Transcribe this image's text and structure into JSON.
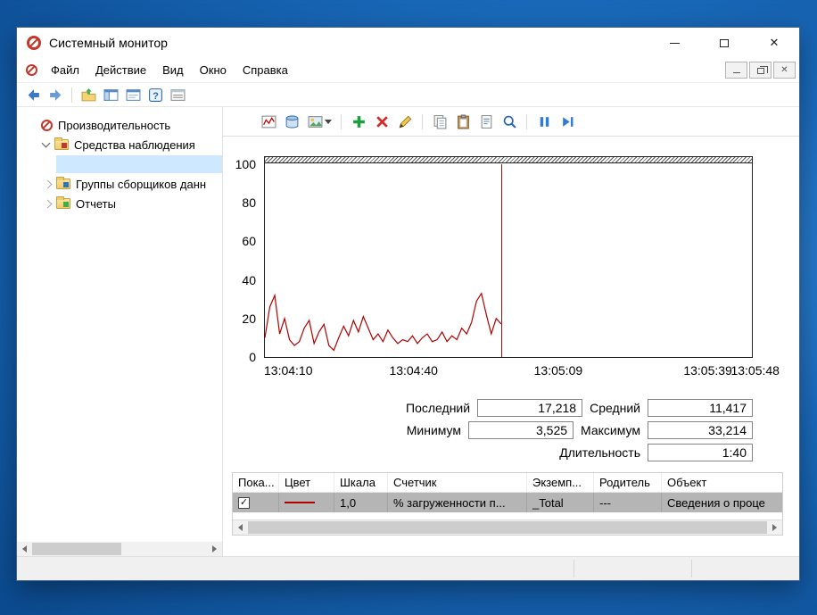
{
  "window": {
    "title": "Системный монитор"
  },
  "menu": {
    "items": [
      "Файл",
      "Действие",
      "Вид",
      "Окно",
      "Справка"
    ]
  },
  "tree": {
    "items": [
      {
        "label": "Производительность"
      },
      {
        "label": "Средства наблюдения"
      },
      {
        "label": ""
      },
      {
        "label": "Группы сборщиков данн"
      },
      {
        "label": "Отчеты"
      }
    ]
  },
  "stats": {
    "last_label": "Последний",
    "last_value": "17,218",
    "avg_label": "Средний",
    "avg_value": "11,417",
    "min_label": "Минимум",
    "min_value": "3,525",
    "max_label": "Максимум",
    "max_value": "33,214",
    "duration_label": "Длительность",
    "duration_value": "1:40"
  },
  "legend": {
    "headers": [
      "Пока...",
      "Цвет",
      "Шкала",
      "Счетчик",
      "Экземп...",
      "Родитель",
      "Объект"
    ],
    "rows": [
      {
        "checked": true,
        "color": "#b00000",
        "scale": "1,0",
        "counter": "% загруженности п...",
        "instance": "_Total",
        "parent": "---",
        "object": "Сведения о проце"
      }
    ]
  },
  "chart_data": {
    "type": "line",
    "title": "",
    "xlabel": "",
    "ylabel": "",
    "ylim": [
      0,
      100
    ],
    "grid": false,
    "yticks": [
      "100",
      "80",
      "60",
      "40",
      "20",
      "0"
    ],
    "xticks": [
      "13:04:10",
      "13:04:40",
      "13:05:09",
      "13:05:39",
      "13:05:48"
    ],
    "cursor_fraction": 0.485,
    "series": [
      {
        "name": "% загруженности процессора",
        "color": "#b00000",
        "values": [
          10,
          26,
          32,
          12,
          20,
          9,
          6,
          8,
          15,
          19,
          7,
          13,
          17,
          6,
          3.5,
          10,
          16,
          11,
          19,
          13,
          21,
          15,
          9,
          12,
          8,
          14,
          10,
          7,
          9,
          8,
          11,
          7,
          10,
          12,
          8,
          9,
          13,
          8,
          11,
          9,
          15,
          12,
          18,
          29,
          33,
          22,
          12,
          20,
          17.2
        ]
      }
    ]
  }
}
